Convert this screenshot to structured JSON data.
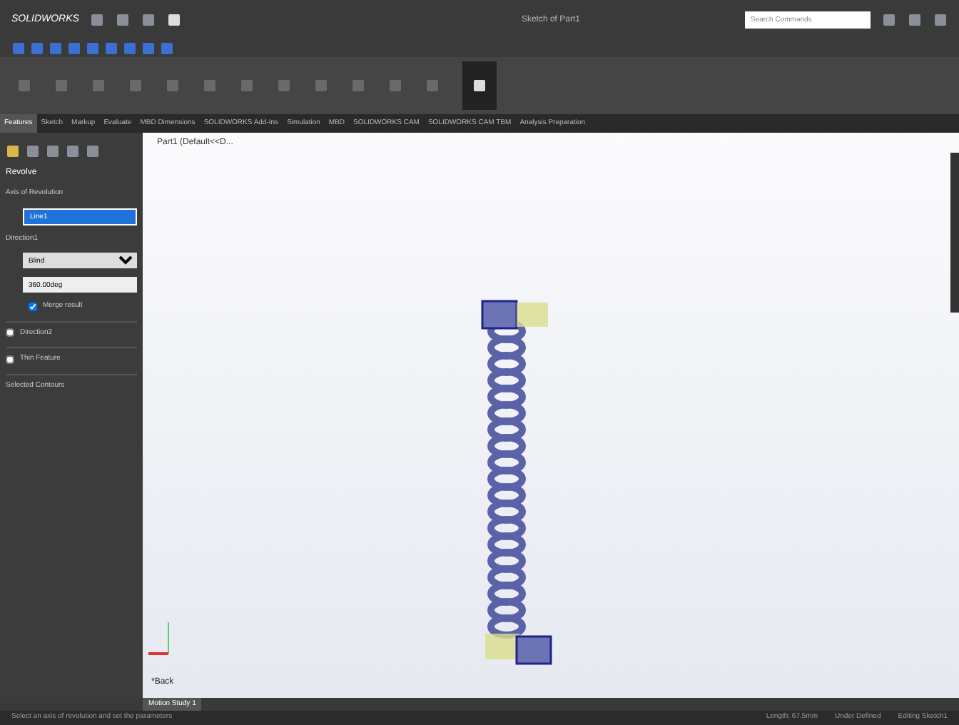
{
  "window": {
    "app": "SOLIDWORKS",
    "title": "Sketch of Part1",
    "search": {
      "placeholder": "Search Commands"
    }
  },
  "ribbon_tabs": [
    {
      "label": "Features",
      "selected": true
    },
    {
      "label": "Sketch",
      "selected": false
    },
    {
      "label": "Markup",
      "selected": false
    },
    {
      "label": "Evaluate",
      "selected": false
    },
    {
      "label": "MBD Dimensions",
      "selected": false
    },
    {
      "label": "SOLIDWORKS Add-Ins",
      "selected": false
    },
    {
      "label": "Simulation",
      "selected": false
    },
    {
      "label": "MBD",
      "selected": false
    },
    {
      "label": "SOLIDWORKS CAM",
      "selected": false
    },
    {
      "label": "SOLIDWORKS CAM TBM",
      "selected": false
    },
    {
      "label": "Analysis Preparation",
      "selected": false
    }
  ],
  "property_manager": {
    "title": "Revolve",
    "axis_section": "Axis of Revolution",
    "axis_value": "Line1",
    "direction_section": "Direction1",
    "end_condition": "Blind",
    "angle": "360.00deg",
    "merge": {
      "label": "Merge result",
      "checked": true
    },
    "collapsed_sections": [
      {
        "label": "Direction2",
        "checked": false
      },
      {
        "label": "Thin Feature",
        "checked": false
      }
    ],
    "contours_section": "Selected Contours"
  },
  "viewport": {
    "tree_root": "Part1 (Default<<D...",
    "view_label": "*Back"
  },
  "bottom_tabs": [
    {
      "label": "Motion Study 1",
      "selected": true
    }
  ],
  "status_bar": {
    "message": "Select an axis of revolution and set the parameters",
    "items": [
      "Length: 67.5mm",
      "Under Defined",
      "Editing Sketch1"
    ]
  }
}
